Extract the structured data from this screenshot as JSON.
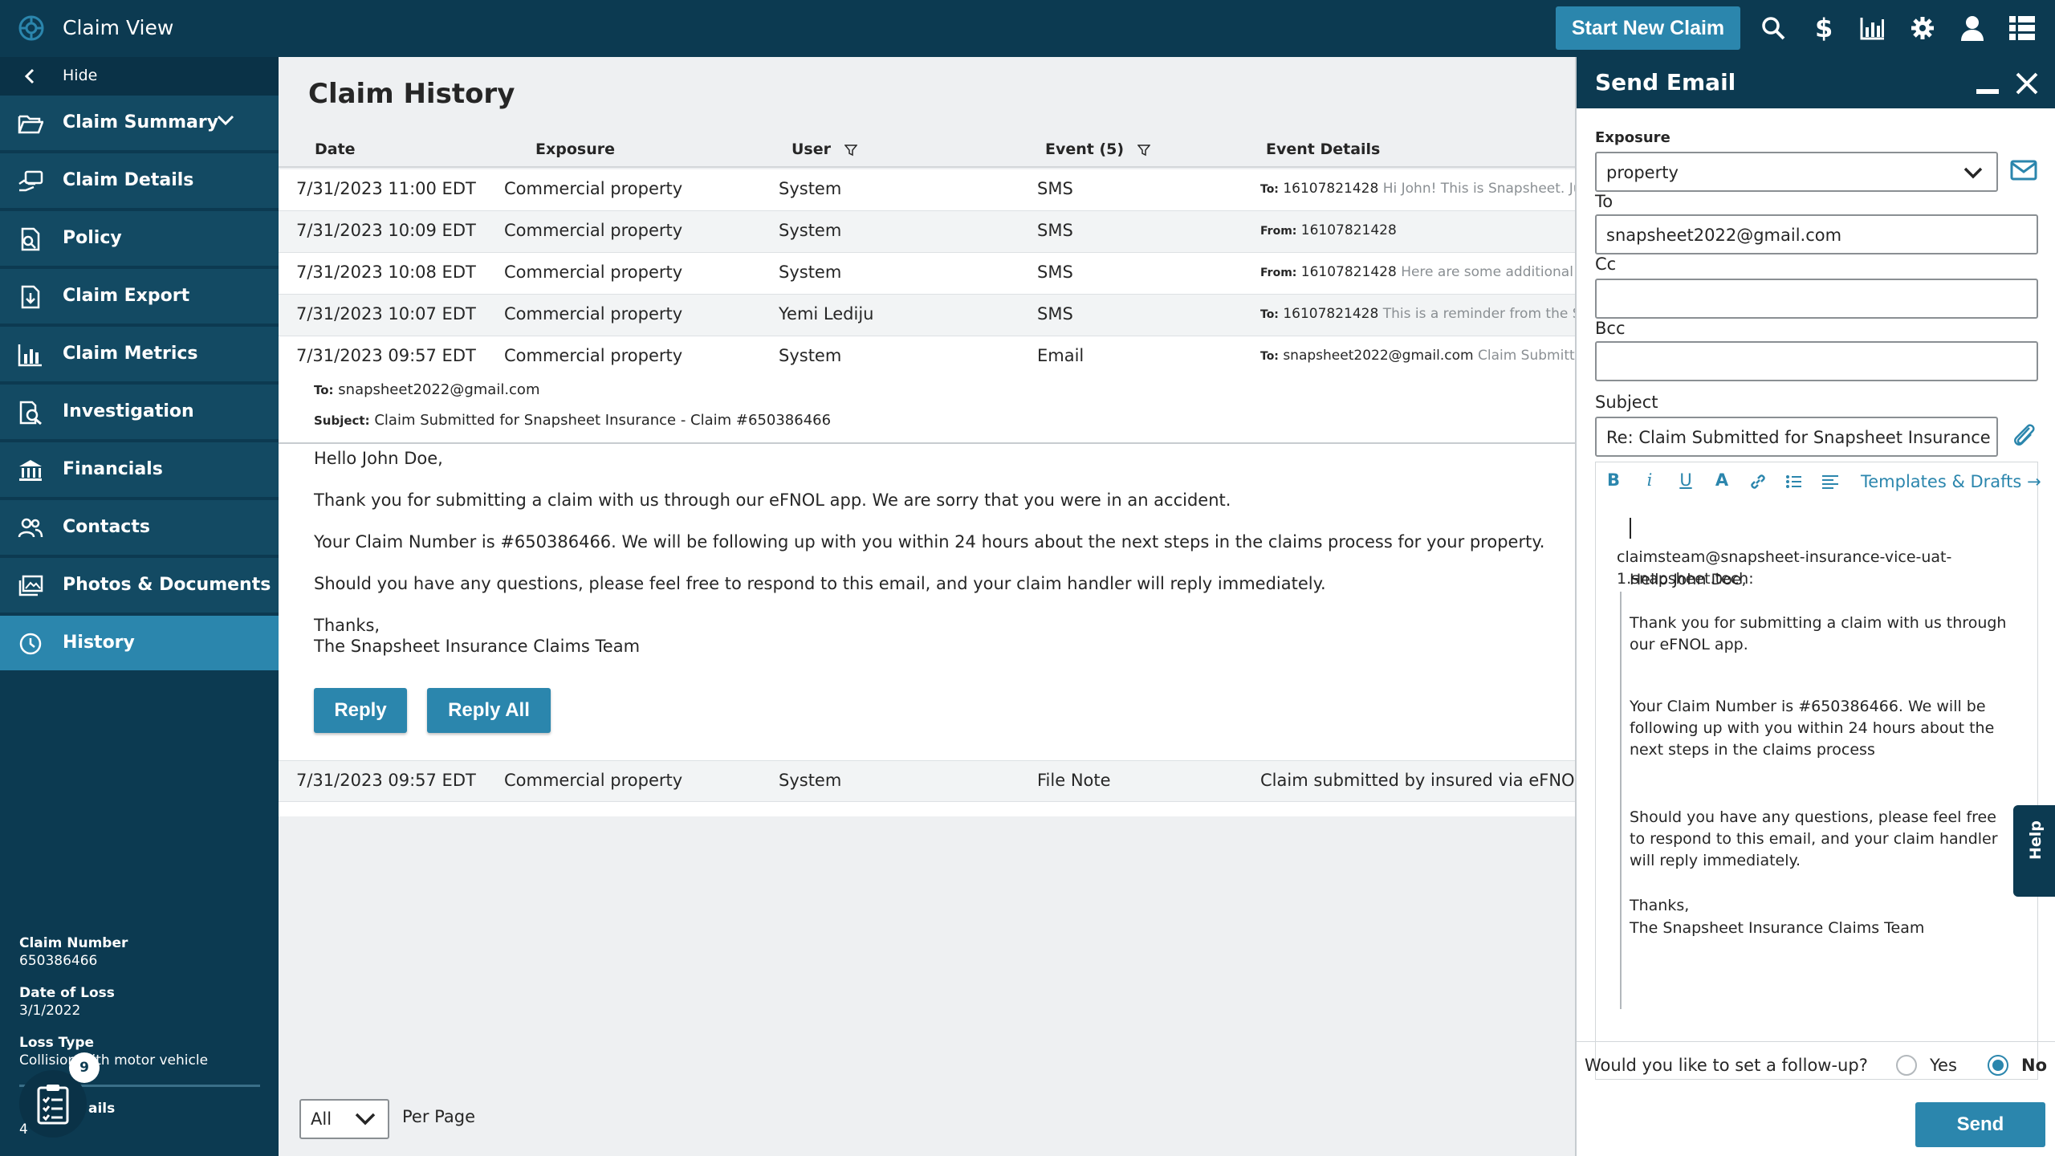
{
  "app": {
    "title": "Claim View"
  },
  "topbar": {
    "new_claim_label": "Start New Claim"
  },
  "sidebar": {
    "hide_label": "Hide",
    "items": [
      {
        "label": "Claim Summary",
        "icon": "folder-open-icon"
      },
      {
        "label": "Claim Details",
        "icon": "hand-card-icon"
      },
      {
        "label": "Policy",
        "icon": "policy-search-icon"
      },
      {
        "label": "Claim Export",
        "icon": "file-export-icon"
      },
      {
        "label": "Claim Metrics",
        "icon": "bar-chart-icon"
      },
      {
        "label": "Investigation",
        "icon": "doc-search-icon"
      },
      {
        "label": "Financials",
        "icon": "bank-icon"
      },
      {
        "label": "Contacts",
        "icon": "people-icon"
      },
      {
        "label": "Photos & Documents",
        "icon": "images-icon"
      },
      {
        "label": "History",
        "icon": "clock-icon"
      }
    ],
    "meta": {
      "claim_number_label": "Claim Number",
      "claim_number": "650386466",
      "date_of_loss_label": "Date of Loss",
      "date_of_loss": "3/1/2022",
      "loss_type_label": "Loss Type",
      "loss_type": "Collision with motor vehicle",
      "partial_label": "ails",
      "partial_value": "4"
    },
    "checklist_count": "9"
  },
  "history": {
    "title": "Claim History",
    "columns": {
      "date": "Date",
      "exposure": "Exposure",
      "user": "User",
      "event": "Event (5)",
      "details": "Event Details"
    },
    "rows": [
      {
        "date": "7/31/2023 11:00 EDT",
        "exposure": "Commercial property",
        "user": "System",
        "event": "SMS",
        "dlabel": "To:",
        "dvalue": "16107821428",
        "dextra": "Hi John! This is Snapsheet. Just"
      },
      {
        "date": "7/31/2023 10:09 EDT",
        "exposure": "Commercial property",
        "user": "System",
        "event": "SMS",
        "dlabel": "From:",
        "dvalue": "16107821428",
        "dextra": ""
      },
      {
        "date": "7/31/2023 10:08 EDT",
        "exposure": "Commercial property",
        "user": "System",
        "event": "SMS",
        "dlabel": "From:",
        "dvalue": "16107821428",
        "dextra": "Here are some additional"
      },
      {
        "date": "7/31/2023 10:07 EDT",
        "exposure": "Commercial property",
        "user": "Yemi Lediju",
        "event": "SMS",
        "dlabel": "To:",
        "dvalue": "16107821428",
        "dextra": "This is a reminder from the S"
      },
      {
        "date": "7/31/2023 09:57 EDT",
        "exposure": "Commercial property",
        "user": "System",
        "event": "Email",
        "dlabel": "To:",
        "dvalue": "snapsheet2022@gmail.com",
        "dextra": "Claim Submitted"
      }
    ],
    "email": {
      "to_label": "To:",
      "to": "snapsheet2022@gmail.com",
      "subject_label": "Subject:",
      "subject": "Claim Submitted for Snapsheet Insurance - Claim #650386466",
      "greeting": "Hello John Doe,",
      "p1": "Thank you for submitting a claim with us through our eFNOL app. We are sorry that you were in an accident.",
      "p2": "Your Claim Number is #650386466. We will be following up with you within 24 hours about the next steps in the claims process for your property.",
      "p3": "Should you have any questions, please feel free to respond to this email, and your claim handler will reply immediately.",
      "sign1": "Thanks,",
      "sign2": "The Snapsheet Insurance Claims Team",
      "reply_label": "Reply",
      "reply_all_label": "Reply All"
    },
    "last_row": {
      "date": "7/31/2023 09:57 EDT",
      "exposure": "Commercial property",
      "user": "System",
      "event": "File Note",
      "details": "Claim submitted by insured via eFNOL"
    },
    "per_page_value": "All",
    "per_page_label": "Per Page"
  },
  "send_email": {
    "title": "Send Email",
    "exposure_label": "Exposure",
    "exposure_value": "property",
    "to_label": "To",
    "to_value": "snapsheet2022@gmail.com",
    "cc_label": "Cc",
    "cc_value": "",
    "bcc_label": "Bcc",
    "bcc_value": "",
    "subject_label": "Subject",
    "subject_value": "Re: Claim Submitted for Snapsheet Insurance - Cl",
    "templates_label": "Templates & Drafts",
    "quote_from": "claimsteam@snapsheet-insurance-vice-uat-1.snapsheet.tech:",
    "quote": {
      "l1": "Hello John Doe,",
      "l2": "Thank you for submitting a claim with us through our eFNOL app.",
      "l3": "Your Claim Number is #650386466. We will be following up with you within 24 hours about the next steps in the claims process",
      "l4": "Should you have any questions, please feel free to respond to this email, and your claim handler will reply immediately.",
      "l5": "Thanks,",
      "l6": "The Snapsheet Insurance Claims Team"
    },
    "followup_question": "Would you like to set a follow-up?",
    "yes_label": "Yes",
    "no_label": "No",
    "followup_selected": "No",
    "send_label": "Send",
    "help_label": "Help"
  },
  "colors": {
    "navy": "#0c3a51",
    "accent": "#2b86ad",
    "nav_item": "#134a63"
  }
}
